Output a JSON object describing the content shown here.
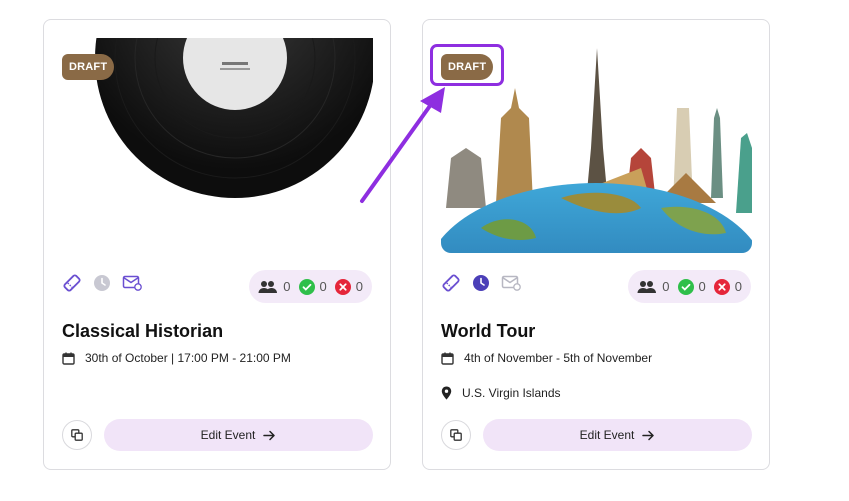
{
  "cards": [
    {
      "badge": "DRAFT",
      "title": "Classical Historian",
      "date": "30th of October | 17:00 PM - 21:00 PM",
      "location": "",
      "stats": {
        "attendees": "0",
        "accepted": "0",
        "declined": "0"
      },
      "edit_label": "Edit Event",
      "image": "vinyl-record-image"
    },
    {
      "badge": "DRAFT",
      "title": "World Tour",
      "date": "4th of November - 5th of November",
      "location": "U.S. Virgin Islands",
      "stats": {
        "attendees": "0",
        "accepted": "0",
        "declined": "0"
      },
      "edit_label": "Edit Event",
      "image": "world-landmarks-image"
    }
  ],
  "colors": {
    "badge": "#8a6a46",
    "accent": "#6a4fd1",
    "highlight": "#8e2ee0",
    "stats_bg": "#f3eaf8",
    "edit_bg": "#f1e4f8",
    "accepted": "#2fbf4a",
    "declined": "#e5263a"
  }
}
